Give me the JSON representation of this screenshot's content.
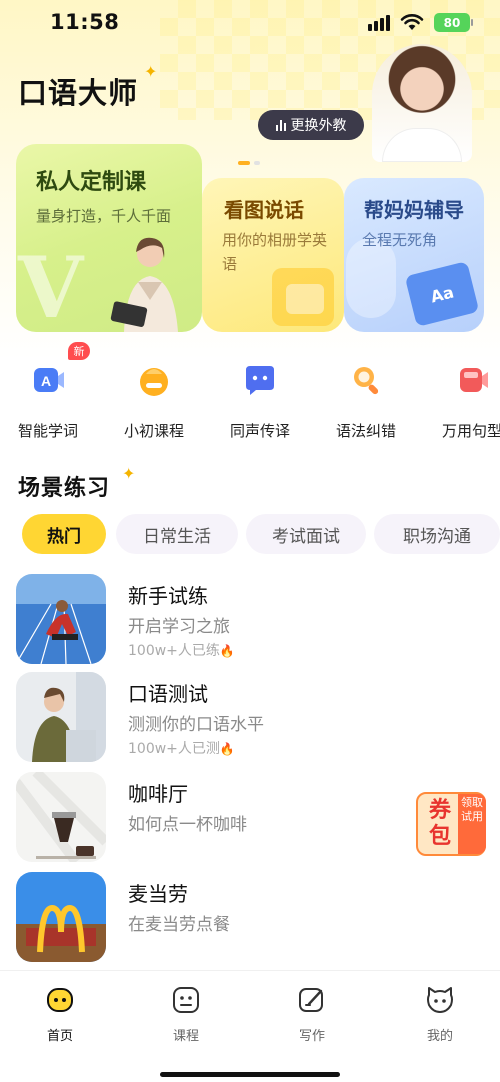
{
  "status_bar": {
    "time": "11:58",
    "battery": "80"
  },
  "header": {
    "app_title": "口语大师",
    "change_teacher_label": "更换外教"
  },
  "feature_cards": [
    {
      "title": "私人定制课",
      "subtitle": "量身打造，千人千面"
    },
    {
      "title": "看图说话",
      "subtitle": "用你的相册学英语"
    },
    {
      "title": "帮妈妈辅导",
      "subtitle": "全程无死角"
    }
  ],
  "quick_tools": [
    {
      "label": "智能学词",
      "icon": "ai-word-icon",
      "badge": "新",
      "color": "#4a7cf6"
    },
    {
      "label": "小初课程",
      "icon": "child-face-icon",
      "color": "#ffb020"
    },
    {
      "label": "同声传译",
      "icon": "chat-bubbles-icon",
      "color": "#4f6ef0"
    },
    {
      "label": "语法纠错",
      "icon": "magnifier-icon",
      "color": "#ff9a3a"
    },
    {
      "label": "万用句型",
      "icon": "sentence-icon",
      "color": "#f25a5a"
    }
  ],
  "scene_practice": {
    "title": "场景练习",
    "tabs": [
      "热门",
      "日常生活",
      "考试面试",
      "职场沟通"
    ],
    "active_tab": 0,
    "items": [
      {
        "title": "新手试练",
        "subtitle": "开启学习之旅",
        "count": "100w+人已练"
      },
      {
        "title": "口语测试",
        "subtitle": "测测你的口语水平",
        "count": "100w+人已测"
      },
      {
        "title": "咖啡厅",
        "subtitle": "如何点一杯咖啡"
      },
      {
        "title": "麦当劳",
        "subtitle": "在麦当劳点餐"
      }
    ]
  },
  "coupon": {
    "main": "券包",
    "side": "领取试用"
  },
  "tab_bar": [
    {
      "label": "首页",
      "icon": "home-face-icon",
      "active": true
    },
    {
      "label": "课程",
      "icon": "course-icon",
      "active": false
    },
    {
      "label": "写作",
      "icon": "write-icon",
      "active": false
    },
    {
      "label": "我的",
      "icon": "profile-cat-icon",
      "active": false
    }
  ],
  "colors": {
    "accent_yellow": "#ffd633",
    "new_badge": "#ff4d4f",
    "coupon_red": "#e8342e"
  }
}
